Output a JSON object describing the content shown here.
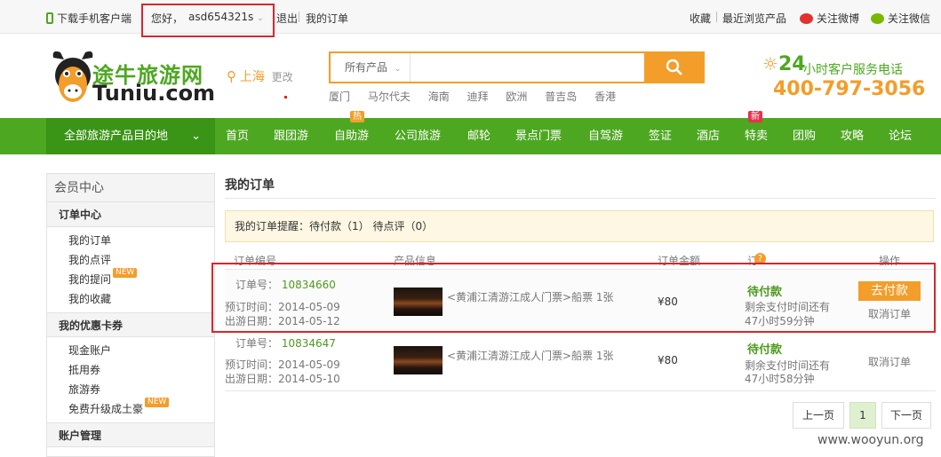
{
  "topbar": {
    "download_app": "下载手机客户端",
    "greeting": "您好，",
    "username": "asd654321s",
    "logout": "退出",
    "my_orders": "我的订单",
    "favorites": "收藏",
    "recent": "最近浏览产品",
    "weibo": "关注微博",
    "wechat": "关注微信"
  },
  "header": {
    "logo_cn": "途牛旅游网",
    "logo_en": "Tuniu.com",
    "city": "上海",
    "change_city": "更改",
    "search_category": "所有产品",
    "search_placeholder": "",
    "hot_words": [
      "厦门",
      "马尔代夫",
      "海南",
      "迪拜",
      "欧洲",
      "普吉岛",
      "香港"
    ],
    "service_24": "24",
    "service_text": "小时客户服务电话",
    "phone": "400-797-3056"
  },
  "nav": {
    "all_products": "全部旅游产品目的地",
    "items": [
      "首页",
      "跟团游",
      "自助游",
      "公司旅游",
      "邮轮",
      "景点门票",
      "自驾游",
      "签证",
      "酒店",
      "特卖",
      "团购",
      "攻略",
      "论坛"
    ],
    "badge_hot": "热",
    "badge_new": "新"
  },
  "sidebar": {
    "title": "会员中心",
    "groups": [
      {
        "label": "订单中心",
        "items": [
          "我的订单",
          "我的点评",
          "我的提问",
          "我的收藏"
        ]
      },
      {
        "label": "我的优惠卡券",
        "items": [
          "现金账户",
          "抵用券",
          "旅游券",
          "免费升级成土豪"
        ]
      },
      {
        "label": "账户管理",
        "items": []
      }
    ],
    "new_badge": "NEW"
  },
  "main": {
    "title": "我的订单",
    "notice": "我的订单提醒：待付款（1）   待点评（0）",
    "columns": [
      "订单编号",
      "产品信息",
      "订单金额",
      "订单状态",
      "操作"
    ],
    "orders": [
      {
        "order_label": "订单号：",
        "order_no": "10834660",
        "book_label": "预订时间：",
        "book_date": "2014-05-09",
        "travel_label": "出游日期：",
        "travel_date": "2014-05-12",
        "product": "<黄浦江清游江成人门票>船票 1张",
        "amount": "¥80",
        "status": "待付款",
        "remain1": "剩余支付时间还有",
        "remain2": "47小时59分钟",
        "pay": "去付款",
        "cancel": "取消订单"
      },
      {
        "order_label": "订单号：",
        "order_no": "10834647",
        "book_label": "预订时间：",
        "book_date": "2014-05-09",
        "travel_label": "出游日期：",
        "travel_date": "2014-05-10",
        "product": "<黄浦江清游江成人门票>船票 1张",
        "amount": "¥80",
        "status": "待付款",
        "remain1": "剩余支付时间还有",
        "remain2": "47小时58分钟",
        "pay": "",
        "cancel": "取消订单"
      }
    ]
  },
  "pager": {
    "prev": "上一页",
    "current": "1",
    "next": "下一页"
  },
  "watermark": "www.wooyun.org",
  "colors": {
    "nav_green": "#4ea721",
    "accent_orange": "#f39d2a",
    "highlight_red": "#d9262c"
  }
}
